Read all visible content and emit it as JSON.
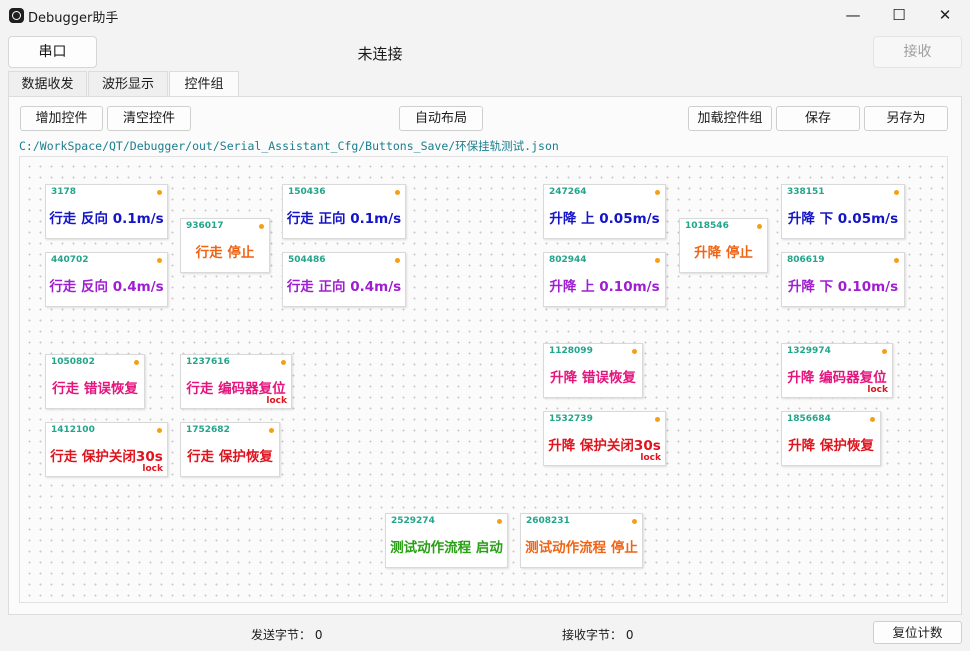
{
  "window": {
    "title": "Debugger助手",
    "minimize": "—",
    "maximize": "☐",
    "close": "✕"
  },
  "top": {
    "serial_button": "串口",
    "status": "未连接",
    "receive_button": "接收"
  },
  "tabs": [
    "数据收发",
    "波形显示",
    "控件组"
  ],
  "toolbar": {
    "add": "增加控件",
    "clear": "清空控件",
    "auto_layout": "自动布局",
    "load": "加载控件组",
    "save": "保存",
    "save_as": "另存为"
  },
  "file_path": "C:/WorkSpace/QT/Debugger/out/Serial_Assistant_Cfg/Buttons_Save/环保挂轨测试.json",
  "widgets": [
    {
      "id": "3178",
      "label": "行走 反向 0.1m/s",
      "color": "#1414c8"
    },
    {
      "id": "936017",
      "label": "行走 停止",
      "color": "#f06414"
    },
    {
      "id": "150436",
      "label": "行走 正向 0.1m/s",
      "color": "#1414c8"
    },
    {
      "id": "247264",
      "label": "升降 上 0.05m/s",
      "color": "#1414c8"
    },
    {
      "id": "1018546",
      "label": "升降 停止",
      "color": "#f06414"
    },
    {
      "id": "338151",
      "label": "升降 下 0.05m/s",
      "color": "#1414c8"
    },
    {
      "id": "440702",
      "label": "行走 反向 0.4m/s",
      "color": "#a01ed2"
    },
    {
      "id": "504486",
      "label": "行走 正向 0.4m/s",
      "color": "#a01ed2"
    },
    {
      "id": "802944",
      "label": "升降 上 0.10m/s",
      "color": "#a01ed2"
    },
    {
      "id": "806619",
      "label": "升降 下 0.10m/s",
      "color": "#a01ed2"
    },
    {
      "id": "1050802",
      "label": "行走 错误恢复",
      "color": "#e6147d"
    },
    {
      "id": "1237616",
      "label": "行走 编码器复位",
      "color": "#e6147d",
      "lock": "lock"
    },
    {
      "id": "1128099",
      "label": "升降 错误恢复",
      "color": "#e6147d"
    },
    {
      "id": "1329974",
      "label": "升降 编码器复位",
      "color": "#e6147d",
      "lock": "lock"
    },
    {
      "id": "1412100",
      "label": "行走 保护关闭30s",
      "color": "#e0141e",
      "lock": "lock"
    },
    {
      "id": "1752682",
      "label": "行走 保护恢复",
      "color": "#e0141e"
    },
    {
      "id": "1532739",
      "label": "升降 保护关闭30s",
      "color": "#e0141e",
      "lock": "lock"
    },
    {
      "id": "1856684",
      "label": "升降 保护恢复",
      "color": "#e0141e"
    },
    {
      "id": "2529274",
      "label": "测试动作流程 启动",
      "color": "#28a014"
    },
    {
      "id": "2608231",
      "label": "测试动作流程 停止",
      "color": "#f06414"
    }
  ],
  "footer": {
    "sent": "发送字节：  0",
    "received": "接收字节：  0",
    "reset": "复位计数"
  }
}
